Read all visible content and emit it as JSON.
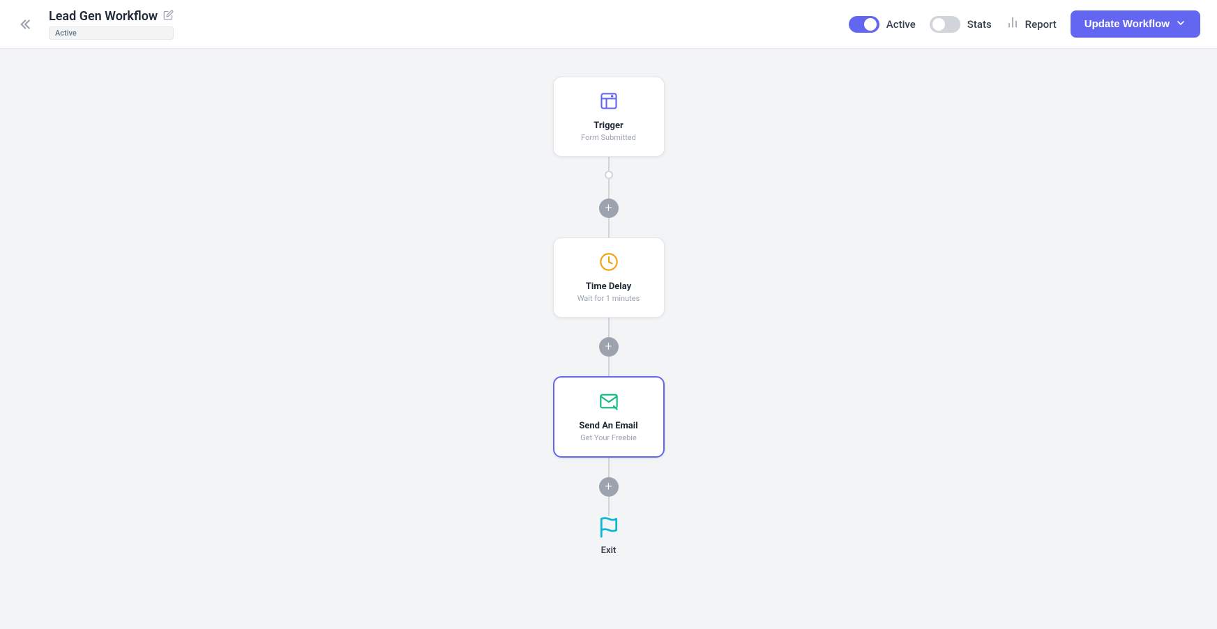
{
  "header": {
    "back_label": "<<",
    "workflow_title": "Lead Gen Workflow",
    "edit_icon": "✏",
    "active_badge": "Active",
    "active_toggle_label": "Active",
    "stats_toggle_label": "Stats",
    "report_label": "Report",
    "update_btn_label": "Update Workflow",
    "update_btn_chevron": "▾"
  },
  "nodes": {
    "trigger": {
      "title": "Trigger",
      "subtitle": "Form Submitted"
    },
    "time_delay": {
      "title": "Time Delay",
      "subtitle": "Wait for 1 minutes"
    },
    "send_email": {
      "title": "Send An Email",
      "subtitle": "Get Your Freebie"
    },
    "exit": {
      "label": "Exit"
    }
  },
  "colors": {
    "accent": "#6366f1",
    "active_toggle": "#6366f1",
    "inactive_toggle": "#d1d5db",
    "connector": "#d1d5db",
    "add_btn": "#9ca3af"
  }
}
